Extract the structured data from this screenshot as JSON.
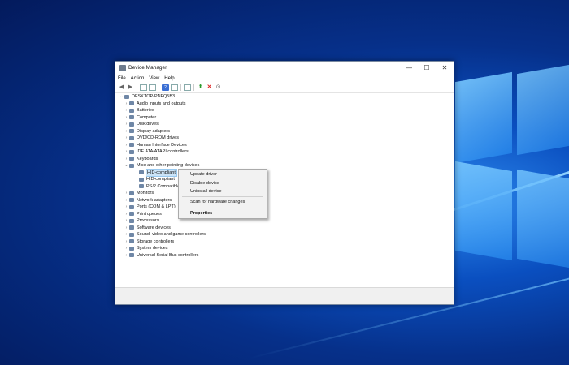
{
  "window": {
    "title": "Device Manager",
    "minimize": "—",
    "maximize": "☐",
    "close": "✕"
  },
  "menu": [
    "File",
    "Action",
    "View",
    "Help"
  ],
  "tree": {
    "root": "DESKTOP-PNFQ5B3",
    "categories": [
      {
        "label": "Audio inputs and outputs",
        "icon": "speaker-icon"
      },
      {
        "label": "Batteries",
        "icon": "battery-icon"
      },
      {
        "label": "Computer",
        "icon": "computer-icon"
      },
      {
        "label": "Disk drives",
        "icon": "disk-icon"
      },
      {
        "label": "Display adapters",
        "icon": "monitor-icon"
      },
      {
        "label": "DVD/CD-ROM drives",
        "icon": "dvd-icon"
      },
      {
        "label": "Human Interface Devices",
        "icon": "hid-icon"
      },
      {
        "label": "IDE ATA/ATAPI controllers",
        "icon": "controller-icon"
      },
      {
        "label": "Keyboards",
        "icon": "keyboard-icon"
      },
      {
        "label": "Mice and other pointing devices",
        "icon": "mouse-icon",
        "expanded": true
      },
      {
        "label": "Monitors",
        "icon": "monitor-icon"
      },
      {
        "label": "Network adapters",
        "icon": "network-icon"
      },
      {
        "label": "Ports (COM & LPT)",
        "icon": "port-icon"
      },
      {
        "label": "Print queues",
        "icon": "printer-icon"
      },
      {
        "label": "Processors",
        "icon": "processor-icon"
      },
      {
        "label": "Software devices",
        "icon": "software-icon"
      },
      {
        "label": "Sound, video and game controllers",
        "icon": "sound-icon"
      },
      {
        "label": "Storage controllers",
        "icon": "storage-icon"
      },
      {
        "label": "System devices",
        "icon": "system-icon"
      },
      {
        "label": "Universal Serial Bus controllers",
        "icon": "usb-icon"
      }
    ],
    "mice_children": [
      "HID-compliant",
      "HID-compliant",
      "PS/2 Compatible"
    ]
  },
  "context_menu": {
    "items": [
      "Update driver",
      "Disable device",
      "Uninstall device",
      "Scan for hardware changes",
      "Properties"
    ]
  }
}
